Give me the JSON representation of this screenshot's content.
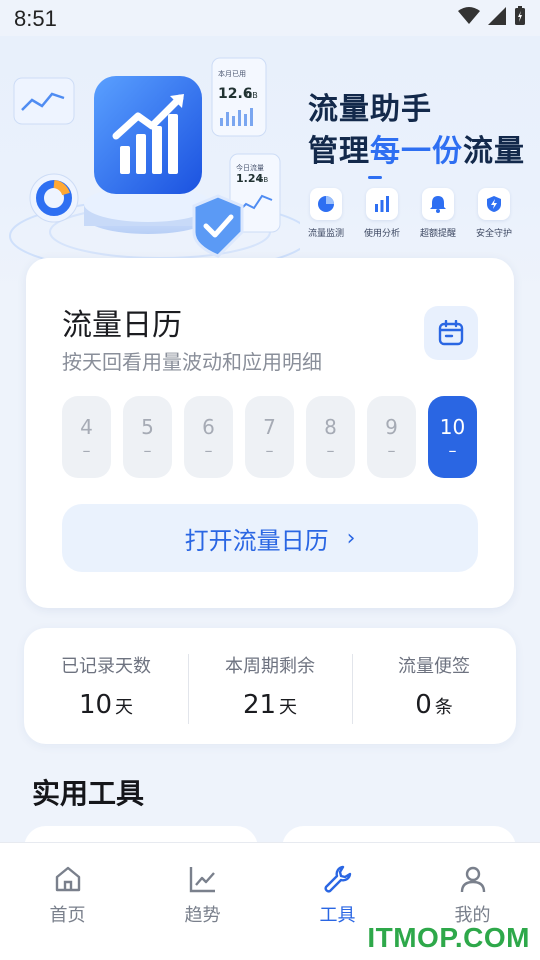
{
  "status_bar": {
    "time": "8:51"
  },
  "banner": {
    "title": "流量助手",
    "subtitle_prefix": "管理",
    "subtitle_accent": "每一份",
    "subtitle_suffix": "流量",
    "art_labels": {
      "month_label": "本月已用",
      "month_value": "12.6",
      "month_unit": "GB",
      "today_label": "今日流量",
      "today_value": "1.24",
      "today_unit": "GB"
    },
    "features": [
      {
        "icon": "pie-chart-icon",
        "label": "流量监测"
      },
      {
        "icon": "bar-chart-icon",
        "label": "使用分析"
      },
      {
        "icon": "bell-icon",
        "label": "超额提醒"
      },
      {
        "icon": "shield-icon",
        "label": "安全守护"
      }
    ]
  },
  "calendar": {
    "title": "流量日历",
    "description": "按天回看用量波动和应用明细",
    "days": [
      {
        "day": "4",
        "usage": "–"
      },
      {
        "day": "5",
        "usage": "–"
      },
      {
        "day": "6",
        "usage": "–"
      },
      {
        "day": "7",
        "usage": "–"
      },
      {
        "day": "8",
        "usage": "–"
      },
      {
        "day": "9",
        "usage": "–"
      },
      {
        "day": "10",
        "usage": "–"
      }
    ],
    "selected_day": "10",
    "open_button": "打开流量日历",
    "open_chevron": "›"
  },
  "stats": [
    {
      "label": "已记录天数",
      "value": "10",
      "unit": "天"
    },
    {
      "label": "本周期剩余",
      "value": "21",
      "unit": "天"
    },
    {
      "label": "流量便签",
      "value": "0",
      "unit": "条"
    }
  ],
  "section_title": "实用工具",
  "nav": [
    {
      "icon": "home-icon",
      "label": "首页",
      "active": false
    },
    {
      "icon": "trend-icon",
      "label": "趋势",
      "active": false
    },
    {
      "icon": "wrench-icon",
      "label": "工具",
      "active": true
    },
    {
      "icon": "user-icon",
      "label": "我的",
      "active": false
    }
  ],
  "watermark": "ITMOP.COM",
  "colors": {
    "accent": "#2a66e3",
    "title": "#13294b",
    "watermark": "#2ea84a"
  }
}
